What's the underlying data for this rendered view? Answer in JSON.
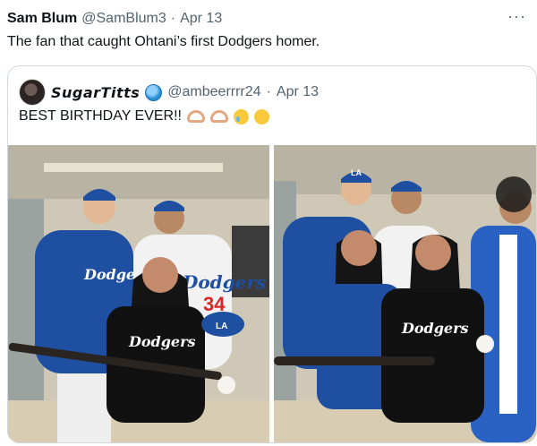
{
  "tweet": {
    "display_name": "Sam Blum",
    "handle": "@SamBlum3",
    "separator": "·",
    "date": "Apr 13",
    "more_label": "···",
    "text": "The fan that caught Ohtani’s first Dodgers homer."
  },
  "quoted": {
    "display_name": "𝙎𝙪𝙜𝙖𝙧𝙏𝙞𝙩𝙩𝙨",
    "badge_icon": "globe-icon",
    "handle": "@ambeerrrr24",
    "separator": "·",
    "date": "Apr 13",
    "text": "BEST BIRTHDAY EVER!!",
    "emojis": [
      "heart-hands-icon",
      "heart-hands-icon",
      "face-holding-back-tears-icon",
      "smiling-face-icon"
    ]
  },
  "photos": {
    "left": {
      "jersey_text": "Dodgers",
      "jersey_number": "34",
      "cap_letters": "LA"
    },
    "right": {
      "jersey_text": "Dodgers",
      "cap_letters": "LA"
    }
  },
  "colors": {
    "dodger_blue": "#1f4fa0",
    "text_primary": "#0f1419",
    "text_muted": "#536471",
    "border": "#cfd9de"
  }
}
